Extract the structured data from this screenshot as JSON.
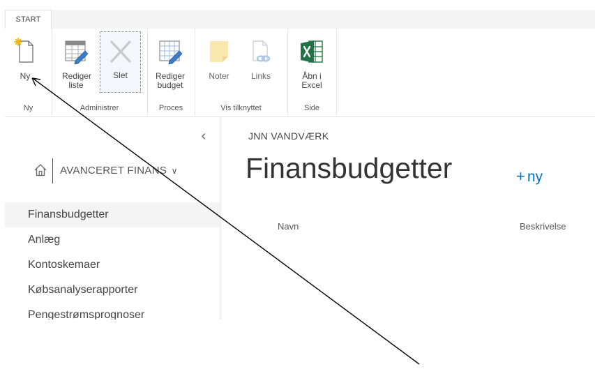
{
  "ribbon": {
    "tab": "START",
    "groups": [
      {
        "label": "Ny",
        "buttons": [
          {
            "label": "Ny"
          }
        ]
      },
      {
        "label": "Administrer",
        "buttons": [
          {
            "label": "Rediger liste"
          },
          {
            "label": "Slet"
          }
        ]
      },
      {
        "label": "Proces",
        "buttons": [
          {
            "label": "Rediger budget"
          }
        ]
      },
      {
        "label": "Vis tilknyttet",
        "buttons": [
          {
            "label": "Noter"
          },
          {
            "label": "Links"
          }
        ]
      },
      {
        "label": "Side",
        "buttons": [
          {
            "label": "Åbn i Excel"
          }
        ]
      }
    ]
  },
  "nav": {
    "collapse_glyph": "‹",
    "site_title": "AVANCERET FINANS",
    "site_title_chevron": "∨",
    "items": [
      {
        "label": "Finansbudgetter",
        "selected": true
      },
      {
        "label": "Anlæg"
      },
      {
        "label": "Kontoskemaer"
      },
      {
        "label": "Købsanalyserapporter"
      },
      {
        "label": "Pengestrømsprognoser"
      }
    ]
  },
  "main": {
    "breadcrumb": "JNN VANDVÆRK",
    "title": "Finansbudgetter",
    "new_plus": "+",
    "new_label": "ny",
    "columns": [
      "Navn",
      "Beskrivelse"
    ]
  },
  "icons": {
    "new": "new-document-icon",
    "edit_list": "edit-list-icon",
    "delete": "delete-x-icon",
    "edit_budget": "edit-budget-icon",
    "notes": "notes-icon",
    "links": "links-icon",
    "excel": "excel-icon",
    "home": "home-icon"
  },
  "colors": {
    "accent": "#0072c6",
    "excel_green": "#217346",
    "notes_yellow": "#fbe7b0",
    "new_star": "#f5b400"
  }
}
